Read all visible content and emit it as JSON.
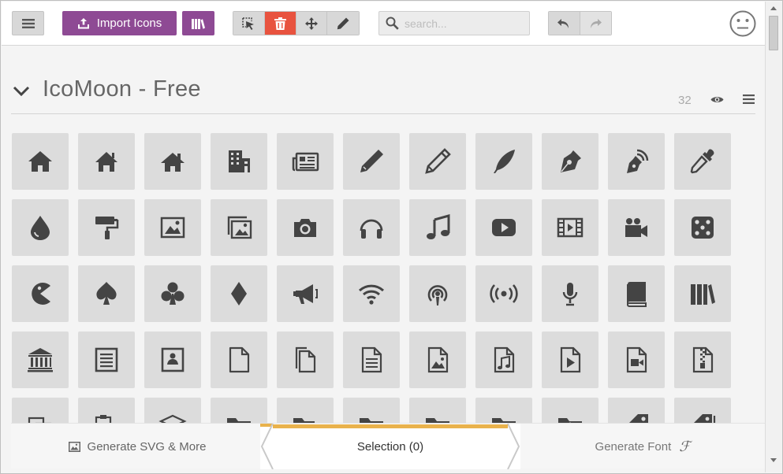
{
  "toolbar": {
    "import_label": "Import Icons",
    "search_placeholder": "search..."
  },
  "icon_set": {
    "title": "IcoMoon - Free",
    "count": "32"
  },
  "bottom_bar": {
    "generate_svg_label": "Generate SVG & More",
    "selection_label": "Selection (0)",
    "generate_font_label": "Generate Font"
  },
  "colors": {
    "accent_purple": "#8e4a94",
    "delete_red": "#e8533f",
    "selection_tab_accent": "#e9b24c",
    "icon_fill": "#444444",
    "tile_bg": "#dcdcdc"
  },
  "icons": [
    "home",
    "home2",
    "home3",
    "office",
    "newspaper",
    "pencil",
    "pencil2",
    "quill",
    "pen",
    "blog",
    "eyedropper",
    "droplet",
    "paint-format",
    "image",
    "images",
    "camera",
    "headphones",
    "music",
    "play",
    "film",
    "video-camera",
    "dice",
    "pacman",
    "spades",
    "clubs",
    "diamonds",
    "bullhorn",
    "connection",
    "podcast",
    "feed",
    "mic",
    "book",
    "books",
    "library",
    "file-text",
    "profile",
    "file-empty",
    "files-empty",
    "file-text2",
    "file-picture",
    "file-music",
    "file-play",
    "file-video",
    "file-zip",
    "copy",
    "paste",
    "stack",
    "folder",
    "folder-open",
    "folder-plus",
    "folder-minus",
    "folder-download",
    "folder-upload",
    "price-tag",
    "price-tags"
  ]
}
